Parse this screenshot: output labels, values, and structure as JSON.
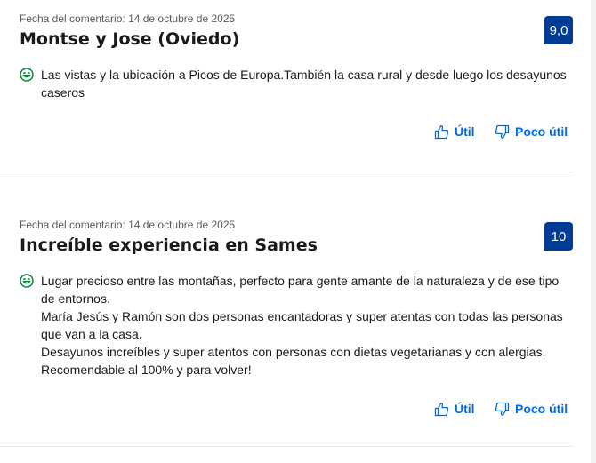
{
  "reviews": [
    {
      "date": "Fecha del comentario: 14 de octubre de 2025",
      "title": "Montse y Jose (Oviedo)",
      "score": "9,0",
      "positive_icon": "smile-icon",
      "lines": [
        "Las vistas y la ubicación a Picos de Europa.También la casa rural y desde luego los desayunos caseros"
      ],
      "helpful_label": "Útil",
      "not_helpful_label": "Poco útil"
    },
    {
      "date": "Fecha del comentario: 14 de octubre de 2025",
      "title": "Increíble experiencia en Sames",
      "score": "10",
      "positive_icon": "smile-icon",
      "lines": [
        "Lugar precioso entre las montañas, perfecto para gente amante de la naturaleza y de ese tipo de entornos.",
        "María Jesús y Ramón son dos personas encantadoras y super atentas con todas las personas que van a la casa.",
        "Desayunos increíbles y super atentos con personas con dietas vegetarianas y con alergias.",
        "Recomendable al 100% y para volver!"
      ],
      "helpful_label": "Útil",
      "not_helpful_label": "Poco útil"
    }
  ],
  "colors": {
    "score_bg": "#003b95",
    "link": "#006ce4",
    "positive": "#008234"
  }
}
